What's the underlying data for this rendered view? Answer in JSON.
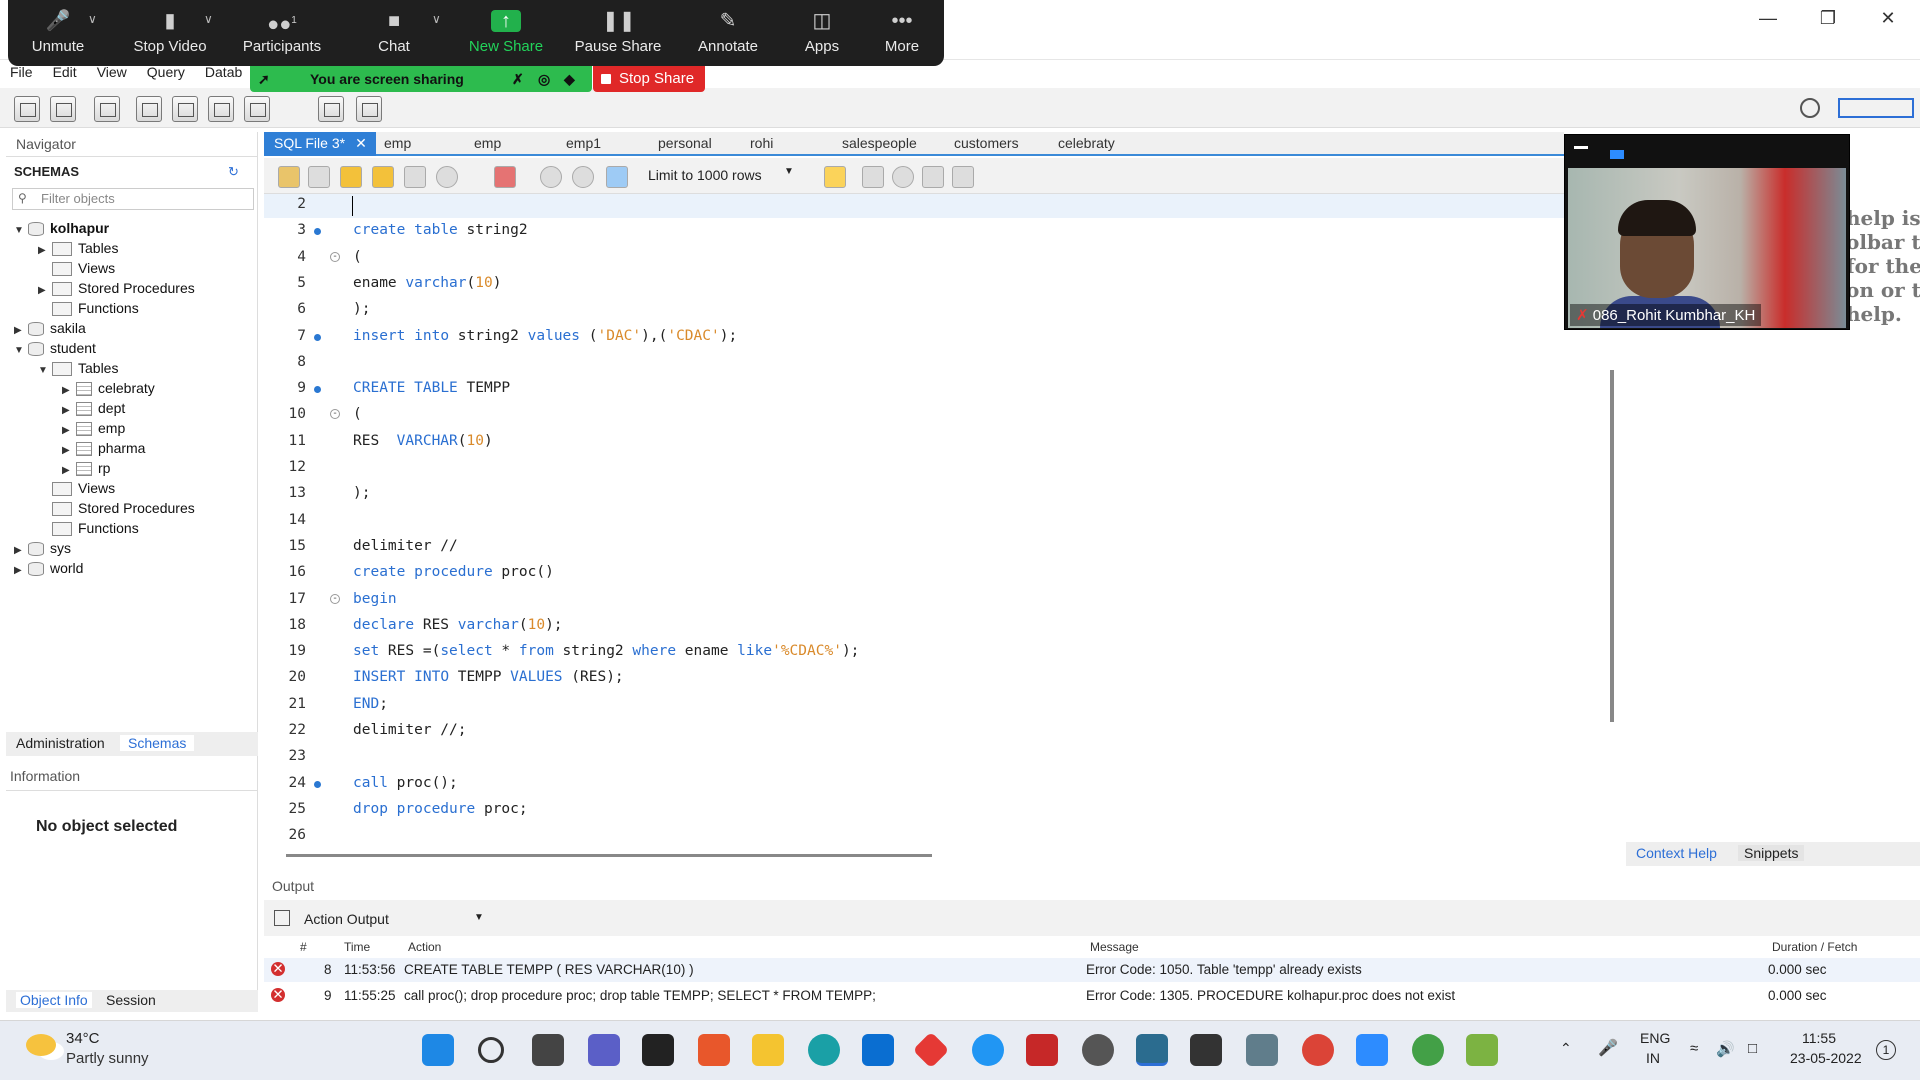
{
  "zoom": {
    "buttons": [
      {
        "label": "Unmute",
        "icon": "mic-muted-icon"
      },
      {
        "label": "Stop Video",
        "icon": "video-icon"
      },
      {
        "label": "Participants",
        "icon": "participants-icon",
        "count": "1"
      },
      {
        "label": "Chat",
        "icon": "chat-icon"
      },
      {
        "label": "New Share",
        "icon": "share-arrow-icon"
      },
      {
        "label": "Pause Share",
        "icon": "pause-icon"
      },
      {
        "label": "Annotate",
        "icon": "pen-icon"
      },
      {
        "label": "Apps",
        "icon": "apps-icon"
      },
      {
        "label": "More",
        "icon": "more-dots-icon"
      }
    ],
    "sharing_banner": "You are screen sharing",
    "stop_share": "Stop Share",
    "green": "#22b14c",
    "red": "#e02828"
  },
  "menu": [
    "File",
    "Edit",
    "View",
    "Query",
    "Datab"
  ],
  "navigator": {
    "title": "Navigator",
    "schemas_title": "SCHEMAS",
    "filter_placeholder": "Filter objects",
    "tree": [
      {
        "label": "kolhapur",
        "bold": true
      },
      {
        "label": "Tables"
      },
      {
        "label": "Views"
      },
      {
        "label": "Stored Procedures"
      },
      {
        "label": "Functions"
      },
      {
        "label": "sakila"
      },
      {
        "label": "student"
      },
      {
        "label": "Tables"
      },
      {
        "label": "celebraty"
      },
      {
        "label": "dept"
      },
      {
        "label": "emp"
      },
      {
        "label": "pharma"
      },
      {
        "label": "rp"
      },
      {
        "label": "Views"
      },
      {
        "label": "Stored Procedures"
      },
      {
        "label": "Functions"
      },
      {
        "label": "sys"
      },
      {
        "label": "world"
      }
    ],
    "tabs": [
      "Administration",
      "Schemas"
    ],
    "info_title": "Information",
    "no_object": "No object selected",
    "bottom_tabs": [
      "Object Info",
      "Session"
    ]
  },
  "editor": {
    "tabs": [
      "SQL File 3*",
      "emp",
      "emp",
      "emp1",
      "personal",
      "rohi",
      "salespeople",
      "customers",
      "celebraty"
    ],
    "limit_label": "Limit to 1000 rows",
    "line_numbers": [
      "2",
      "3",
      "4",
      "5",
      "6",
      "7",
      "8",
      "9",
      "10",
      "11",
      "12",
      "13",
      "14",
      "15",
      "16",
      "17",
      "18",
      "19",
      "20",
      "21",
      "22",
      "23",
      "24",
      "25",
      "26"
    ],
    "lines": [
      "",
      "create table string2",
      "(",
      "ename varchar(10)",
      ");",
      "insert into string2 values ('DAC'),('CDAC');",
      "",
      "CREATE TABLE TEMPP",
      "(",
      "RES  VARCHAR(10)",
      "",
      ");",
      "",
      "delimiter //",
      "create procedure proc()",
      "begin",
      "declare RES varchar(10);",
      "set RES =(select * from string2 where ename like'%CDAC%');",
      "INSERT INTO TEMPP VALUES (RES);",
      "END;",
      "delimiter //;",
      "",
      "call proc();",
      "drop procedure proc;",
      ""
    ]
  },
  "right_panel": {
    "help_text": "help is\nolbar t\nfor the\non or to\nhelp.",
    "tabs": [
      "Context Help",
      "Snippets"
    ]
  },
  "webcam": {
    "name": "086_Rohit Kumbhar_KH"
  },
  "output": {
    "title": "Output",
    "selector": "Action Output",
    "columns": [
      "#",
      "Time",
      "Action",
      "Message",
      "Duration / Fetch"
    ],
    "rows": [
      {
        "num": "8",
        "time": "11:53:56",
        "action": "CREATE TABLE TEMPP ( RES  VARCHAR(10) )",
        "message": "Error Code: 1050. Table 'tempp' already exists",
        "duration": "0.000 sec"
      },
      {
        "num": "9",
        "time": "11:55:25",
        "action": "call proc(); drop procedure proc;  drop table TEMPP; SELECT * FROM TEMPP;",
        "message": "Error Code: 1305. PROCEDURE kolhapur.proc does not exist",
        "duration": "0.000 sec"
      }
    ]
  },
  "taskbar": {
    "temp": "34°C",
    "weather": "Partly sunny",
    "lang1": "ENG",
    "lang2": "IN",
    "time": "11:55",
    "date": "23-05-2022",
    "notifications": "1"
  }
}
